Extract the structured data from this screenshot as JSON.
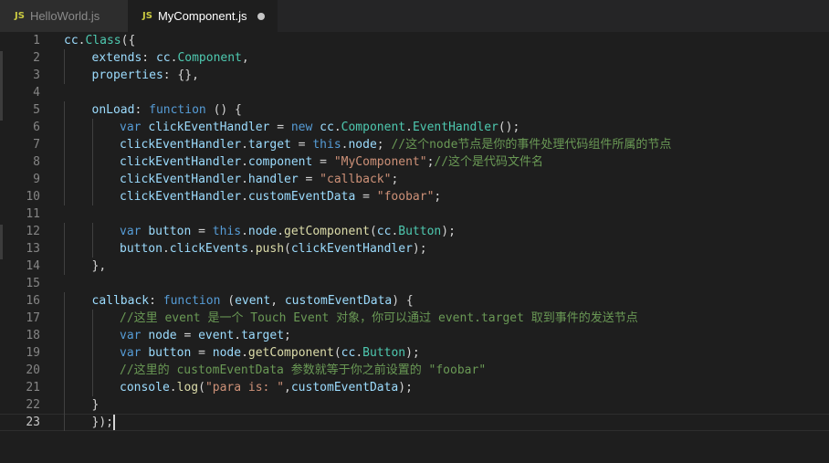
{
  "tabs": [
    {
      "badge": "JS",
      "title": "HelloWorld.js",
      "active": false,
      "dirty": false
    },
    {
      "badge": "JS",
      "title": "MyComponent.js",
      "active": true,
      "dirty": true
    }
  ],
  "editor": {
    "current_line": 23,
    "lines": [
      {
        "n": "1",
        "indent": 0,
        "tokens": [
          [
            "id",
            "cc"
          ],
          [
            "pn",
            "."
          ],
          [
            "cls",
            "Class"
          ],
          [
            "pn",
            "({"
          ]
        ]
      },
      {
        "n": "2",
        "indent": 1,
        "tokens": [
          [
            "id",
            "extends"
          ],
          [
            "pn",
            ": "
          ],
          [
            "id",
            "cc"
          ],
          [
            "pn",
            "."
          ],
          [
            "cls",
            "Component"
          ],
          [
            "pn",
            ","
          ]
        ]
      },
      {
        "n": "3",
        "indent": 1,
        "tokens": [
          [
            "id",
            "properties"
          ],
          [
            "pn",
            ": {},"
          ]
        ]
      },
      {
        "n": "4",
        "indent": 0,
        "tokens": []
      },
      {
        "n": "5",
        "indent": 1,
        "tokens": [
          [
            "id",
            "onLoad"
          ],
          [
            "pn",
            ": "
          ],
          [
            "kw",
            "function"
          ],
          [
            "pn",
            " () {"
          ]
        ]
      },
      {
        "n": "6",
        "indent": 2,
        "tokens": [
          [
            "kw",
            "var"
          ],
          [
            "pn",
            " "
          ],
          [
            "id",
            "clickEventHandler"
          ],
          [
            "pn",
            " = "
          ],
          [
            "kw",
            "new"
          ],
          [
            "pn",
            " "
          ],
          [
            "id",
            "cc"
          ],
          [
            "pn",
            "."
          ],
          [
            "cls",
            "Component"
          ],
          [
            "pn",
            "."
          ],
          [
            "cls",
            "EventHandler"
          ],
          [
            "pn",
            "();"
          ]
        ]
      },
      {
        "n": "7",
        "indent": 2,
        "tokens": [
          [
            "id",
            "clickEventHandler"
          ],
          [
            "pn",
            "."
          ],
          [
            "id",
            "target"
          ],
          [
            "pn",
            " = "
          ],
          [
            "kw",
            "this"
          ],
          [
            "pn",
            "."
          ],
          [
            "id",
            "node"
          ],
          [
            "pn",
            "; "
          ],
          [
            "cm",
            "//这个node节点是你的事件处理代码组件所属的节点"
          ]
        ]
      },
      {
        "n": "8",
        "indent": 2,
        "tokens": [
          [
            "id",
            "clickEventHandler"
          ],
          [
            "pn",
            "."
          ],
          [
            "id",
            "component"
          ],
          [
            "pn",
            " = "
          ],
          [
            "str",
            "\"MyComponent\""
          ],
          [
            "pn",
            ";"
          ],
          [
            "cm",
            "//这个是代码文件名"
          ]
        ]
      },
      {
        "n": "9",
        "indent": 2,
        "tokens": [
          [
            "id",
            "clickEventHandler"
          ],
          [
            "pn",
            "."
          ],
          [
            "id",
            "handler"
          ],
          [
            "pn",
            " = "
          ],
          [
            "str",
            "\"callback\""
          ],
          [
            "pn",
            ";"
          ]
        ]
      },
      {
        "n": "10",
        "indent": 2,
        "tokens": [
          [
            "id",
            "clickEventHandler"
          ],
          [
            "pn",
            "."
          ],
          [
            "id",
            "customEventData"
          ],
          [
            "pn",
            " = "
          ],
          [
            "str",
            "\"foobar\""
          ],
          [
            "pn",
            ";"
          ]
        ]
      },
      {
        "n": "11",
        "indent": 0,
        "tokens": []
      },
      {
        "n": "12",
        "indent": 2,
        "tokens": [
          [
            "kw",
            "var"
          ],
          [
            "pn",
            " "
          ],
          [
            "id",
            "button"
          ],
          [
            "pn",
            " = "
          ],
          [
            "kw",
            "this"
          ],
          [
            "pn",
            "."
          ],
          [
            "id",
            "node"
          ],
          [
            "pn",
            "."
          ],
          [
            "fn",
            "getComponent"
          ],
          [
            "pn",
            "("
          ],
          [
            "id",
            "cc"
          ],
          [
            "pn",
            "."
          ],
          [
            "cls",
            "Button"
          ],
          [
            "pn",
            ");"
          ]
        ]
      },
      {
        "n": "13",
        "indent": 2,
        "tokens": [
          [
            "id",
            "button"
          ],
          [
            "pn",
            "."
          ],
          [
            "id",
            "clickEvents"
          ],
          [
            "pn",
            "."
          ],
          [
            "fn",
            "push"
          ],
          [
            "pn",
            "("
          ],
          [
            "id",
            "clickEventHandler"
          ],
          [
            "pn",
            ");"
          ]
        ]
      },
      {
        "n": "14",
        "indent": 1,
        "tokens": [
          [
            "pn",
            "},"
          ]
        ]
      },
      {
        "n": "15",
        "indent": 0,
        "tokens": []
      },
      {
        "n": "16",
        "indent": 1,
        "tokens": [
          [
            "id",
            "callback"
          ],
          [
            "pn",
            ": "
          ],
          [
            "kw",
            "function"
          ],
          [
            "pn",
            " ("
          ],
          [
            "id",
            "event"
          ],
          [
            "pn",
            ", "
          ],
          [
            "id",
            "customEventData"
          ],
          [
            "pn",
            ") {"
          ]
        ]
      },
      {
        "n": "17",
        "indent": 2,
        "tokens": [
          [
            "cm",
            "//这里 event 是一个 Touch Event 对象，你可以通过 event.target 取到事件的发送节点"
          ]
        ]
      },
      {
        "n": "18",
        "indent": 2,
        "tokens": [
          [
            "kw",
            "var"
          ],
          [
            "pn",
            " "
          ],
          [
            "id",
            "node"
          ],
          [
            "pn",
            " = "
          ],
          [
            "id",
            "event"
          ],
          [
            "pn",
            "."
          ],
          [
            "id",
            "target"
          ],
          [
            "pn",
            ";"
          ]
        ]
      },
      {
        "n": "19",
        "indent": 2,
        "tokens": [
          [
            "kw",
            "var"
          ],
          [
            "pn",
            " "
          ],
          [
            "id",
            "button"
          ],
          [
            "pn",
            " = "
          ],
          [
            "id",
            "node"
          ],
          [
            "pn",
            "."
          ],
          [
            "fn",
            "getComponent"
          ],
          [
            "pn",
            "("
          ],
          [
            "id",
            "cc"
          ],
          [
            "pn",
            "."
          ],
          [
            "cls",
            "Button"
          ],
          [
            "pn",
            ");"
          ]
        ]
      },
      {
        "n": "20",
        "indent": 2,
        "tokens": [
          [
            "cm",
            "//这里的 customEventData 参数就等于你之前设置的 \"foobar\""
          ]
        ]
      },
      {
        "n": "21",
        "indent": 2,
        "tokens": [
          [
            "id",
            "console"
          ],
          [
            "pn",
            "."
          ],
          [
            "fn",
            "log"
          ],
          [
            "pn",
            "("
          ],
          [
            "str",
            "\"para is: \""
          ],
          [
            "pn",
            ","
          ],
          [
            "id",
            "customEventData"
          ],
          [
            "pn",
            ");"
          ]
        ]
      },
      {
        "n": "22",
        "indent": 1,
        "tokens": [
          [
            "pn",
            "}"
          ]
        ]
      },
      {
        "n": "23",
        "indent": 1,
        "tokens": [
          [
            "pn",
            "});"
          ]
        ]
      }
    ]
  },
  "colors": {
    "background": "#1e1e1e",
    "tab_bar": "#252526",
    "keyword": "#569cd6",
    "identifier": "#9cdcfe",
    "function": "#dcdcaa",
    "string": "#ce9178",
    "comment": "#6a9955",
    "class": "#4ec9b0"
  }
}
